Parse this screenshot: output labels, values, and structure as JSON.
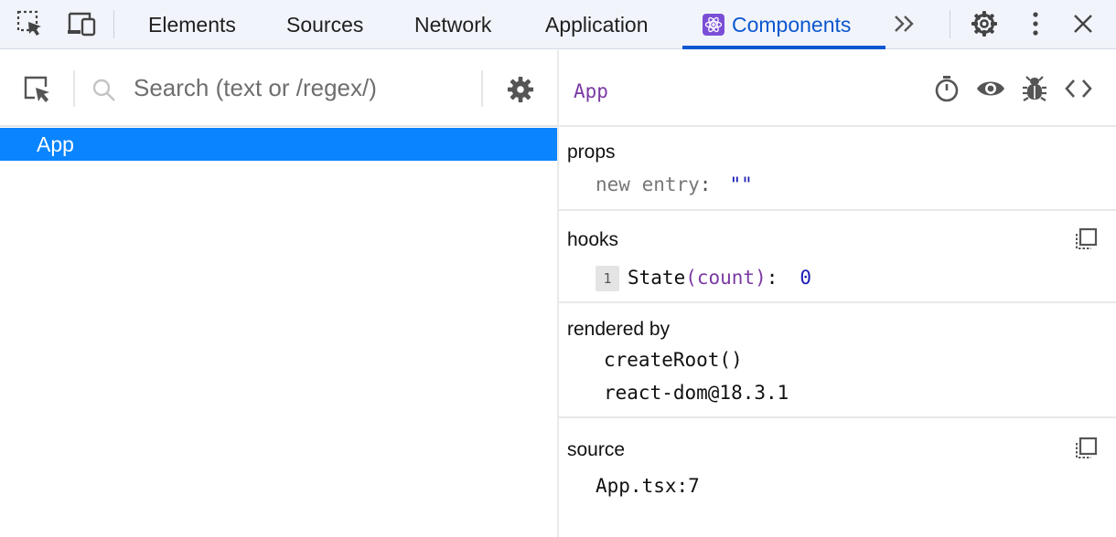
{
  "toolbar": {
    "tabs": [
      {
        "label": "Elements"
      },
      {
        "label": "Sources"
      },
      {
        "label": "Network"
      },
      {
        "label": "Application"
      },
      {
        "label": "Components",
        "active": true
      }
    ],
    "icons": [
      "inspect-element-icon",
      "device-toggle-icon",
      "more-tabs-chevron-icon",
      "settings-gear-icon",
      "more-vertical-icon",
      "close-icon"
    ],
    "accent": "#0b57d0"
  },
  "tree": {
    "search_placeholder": "Search (text or /regex/)",
    "selected_row": "App",
    "selected_color": "#0a84ff"
  },
  "inspector": {
    "component_name": "App",
    "props": {
      "title": "props",
      "key": "new entry",
      "sep": ":",
      "value": "\"\""
    },
    "hooks": {
      "title": "hooks",
      "index": "1",
      "name": "State",
      "arg": "(count)",
      "sep": ":",
      "value": "0"
    },
    "rendered_by": {
      "title": "rendered by",
      "items": [
        "createRoot()",
        "react-dom@18.3.1"
      ]
    },
    "source": {
      "title": "source",
      "location": "App.tsx:7"
    }
  }
}
